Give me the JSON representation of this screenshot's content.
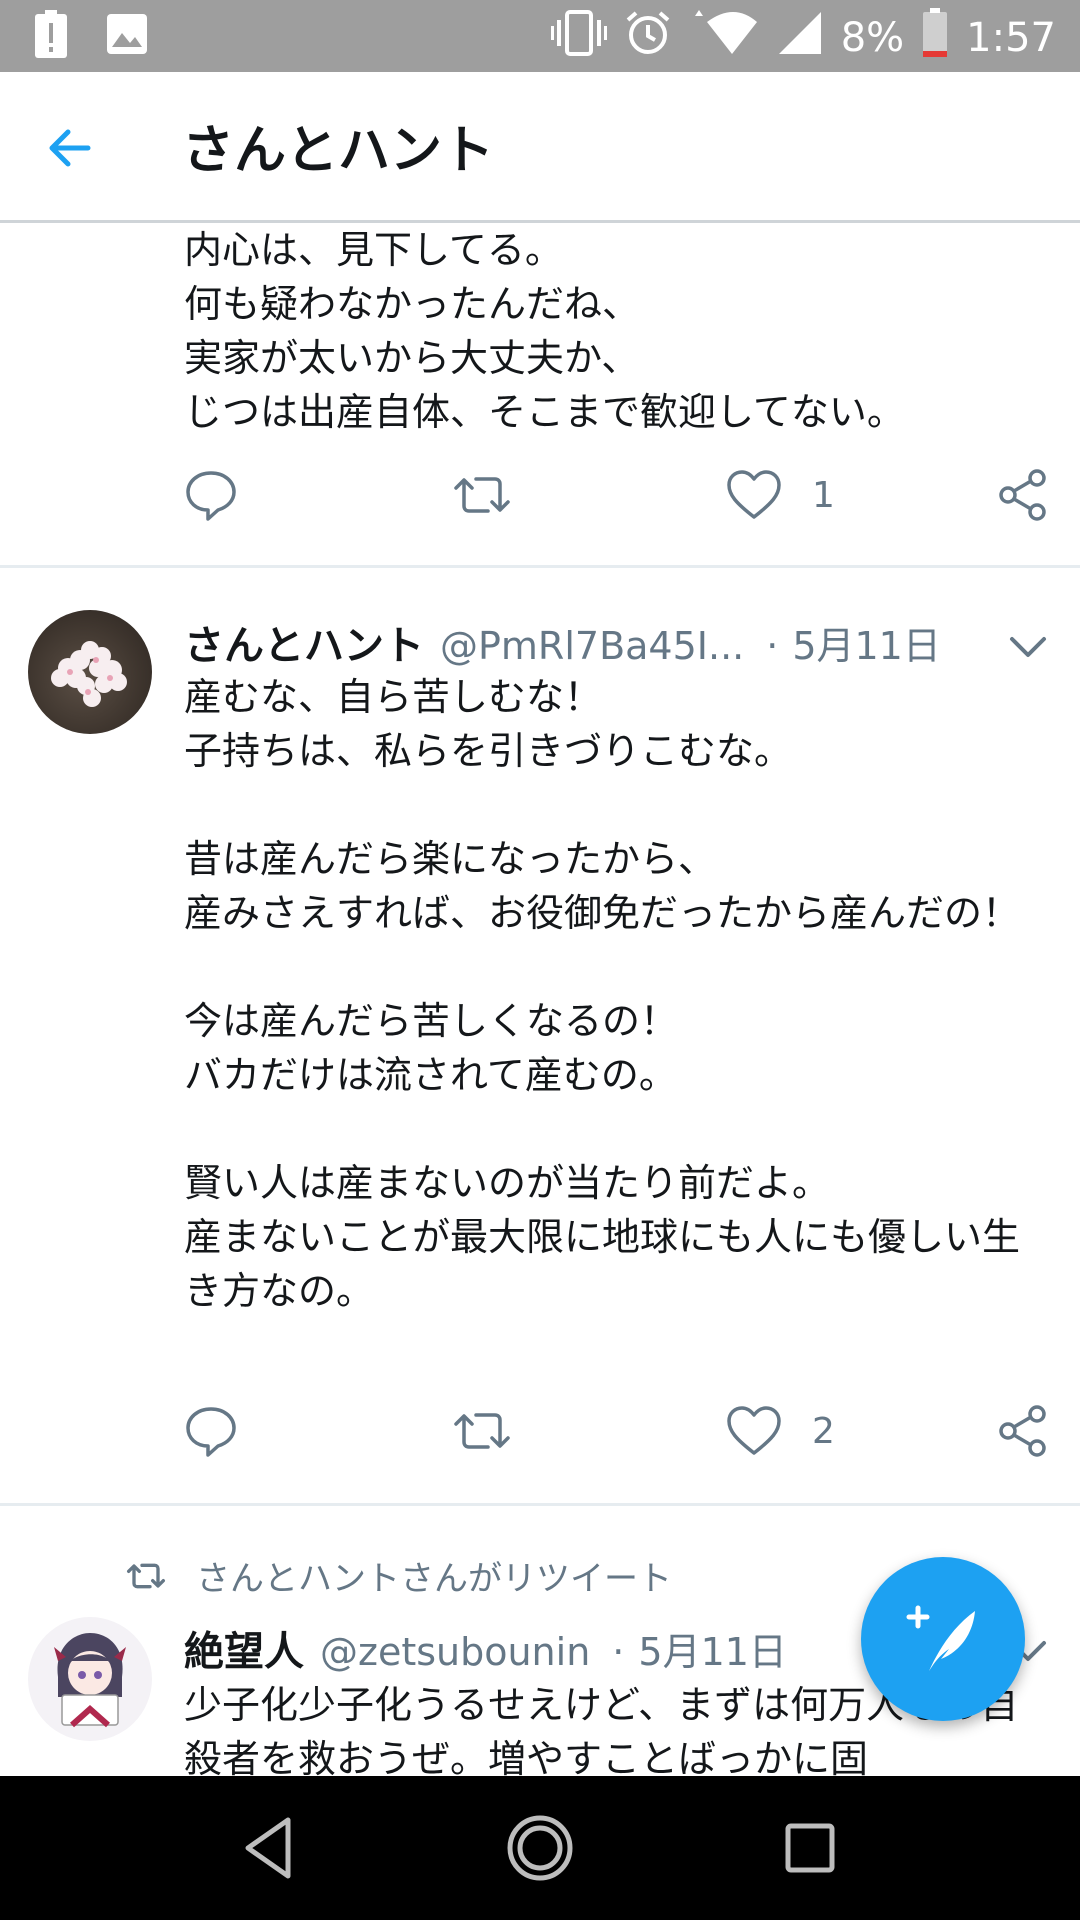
{
  "status_bar": {
    "battery_percent": "8%",
    "time": "1:57",
    "icons": [
      "alert-icon",
      "image-icon",
      "vibrate-icon",
      "alarm-icon",
      "wifi-icon",
      "signal-icon",
      "battery-icon"
    ]
  },
  "header": {
    "title": "さんとハント"
  },
  "tweets": [
    {
      "text": "内心は、見下してる。\n何も疑わなかったんだね、\n実家が太いから大丈夫か、\nじつは出産自体、そこまで歓迎してない。",
      "likes": "1"
    },
    {
      "name": "さんとハント",
      "handle": "@PmRl7Ba45I...",
      "dot": "·",
      "date": "5月11日",
      "text": "産むな、自ら苦しむな！\n子持ちは、私らを引きづりこむな。\n\n昔は産んだら楽になったから、\n産みさえすれば、お役御免だったから産んだの！\n\n今は産んだら苦しくなるの！\nバカだけは流されて産むの。\n\n賢い人は産まないのが当たり前だよ。\n産まないことが最大限に地球にも人にも優しい生き方なの。",
      "likes": "2"
    },
    {
      "retweeted_by": "さんとハントさんがリツイート",
      "name": "絶望人",
      "handle": "@zetsubounin",
      "dot": "·",
      "date": "5月11日",
      "text": "少子化少子化うるせえけど、まずは何万人もの自殺者を救おうぜ。増やすことばっかに固"
    }
  ],
  "colors": {
    "accent": "#1da1f2",
    "secondary_text": "#657786",
    "status_bar": "#9e9e9e"
  }
}
